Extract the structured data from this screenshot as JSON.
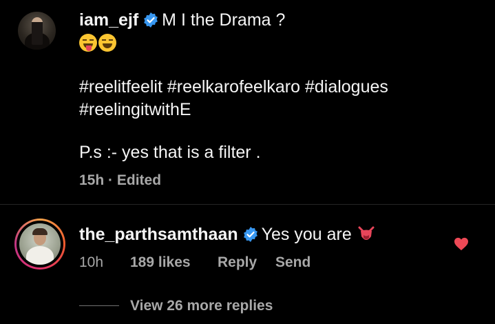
{
  "caption": {
    "username": "iam_ejf",
    "text": "M I the Drama ?",
    "emoji": [
      "stuck-out-tongue-winking-eye-emoji",
      "grinning-squinting-emoji"
    ],
    "hashtags_line1": "#reelitfeelit #reelkarofeelkaro #dialogues",
    "hashtags_line2": "#reelingitwithE",
    "ps": "P.s :- yes that is a filter .",
    "time": "15h",
    "separator": "·",
    "edited": "Edited"
  },
  "comment": {
    "username": "the_parthsamthaan",
    "text": "Yes you are",
    "emoji": "devil-tongue-emoji",
    "time": "10h",
    "likes": "189 likes",
    "reply_label": "Reply",
    "send_label": "Send",
    "liked": true
  },
  "replies": {
    "view_more": "View 26 more replies"
  },
  "colors": {
    "background": "#000000",
    "text": "#f5f5f5",
    "meta": "#a8a8a8",
    "verified": "#3897f0",
    "heart": "#ed4956"
  }
}
